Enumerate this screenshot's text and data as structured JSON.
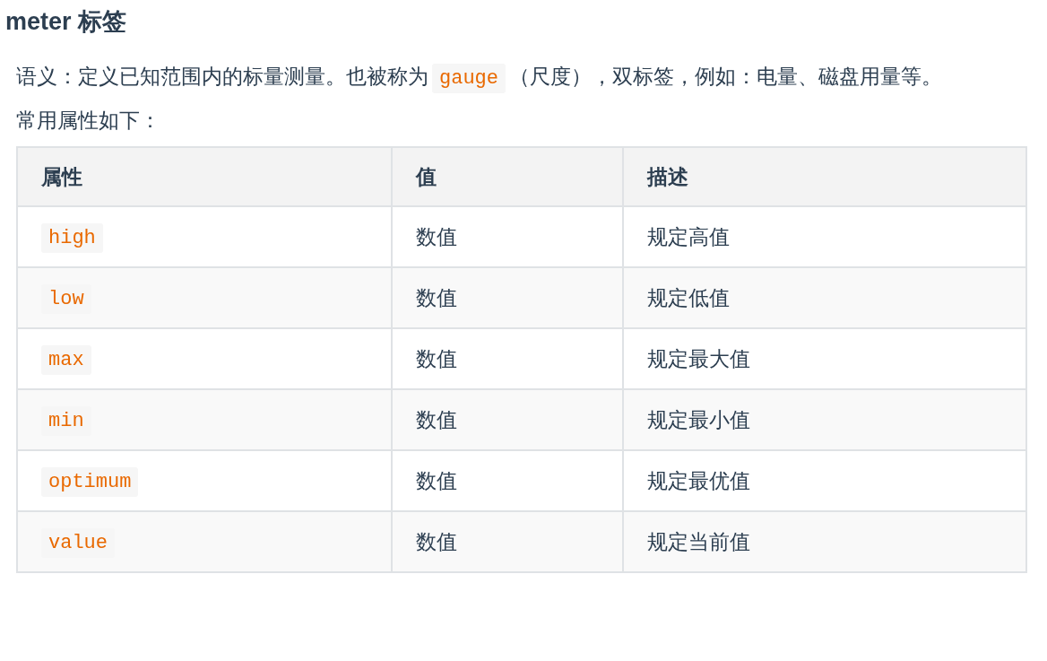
{
  "heading": "meter 标签",
  "intro": [
    {
      "kind": "text",
      "text": "语义：定义已知范围内的标量测量。也被称为"
    },
    {
      "kind": "code",
      "text": "gauge"
    },
    {
      "kind": "text",
      "text": "（尺度），双标签，例如：电量、磁盘用量等。"
    }
  ],
  "lead": "常用属性如下：",
  "table": {
    "columns": [
      "属性",
      "值",
      "描述"
    ],
    "rows": [
      [
        "high",
        "数值",
        "规定高值"
      ],
      [
        "low",
        "数值",
        "规定低值"
      ],
      [
        "max",
        "数值",
        "规定最大值"
      ],
      [
        "min",
        "数值",
        "规定最小值"
      ],
      [
        "optimum",
        "数值",
        "规定最优值"
      ],
      [
        "value",
        "数值",
        "规定当前值"
      ]
    ]
  }
}
